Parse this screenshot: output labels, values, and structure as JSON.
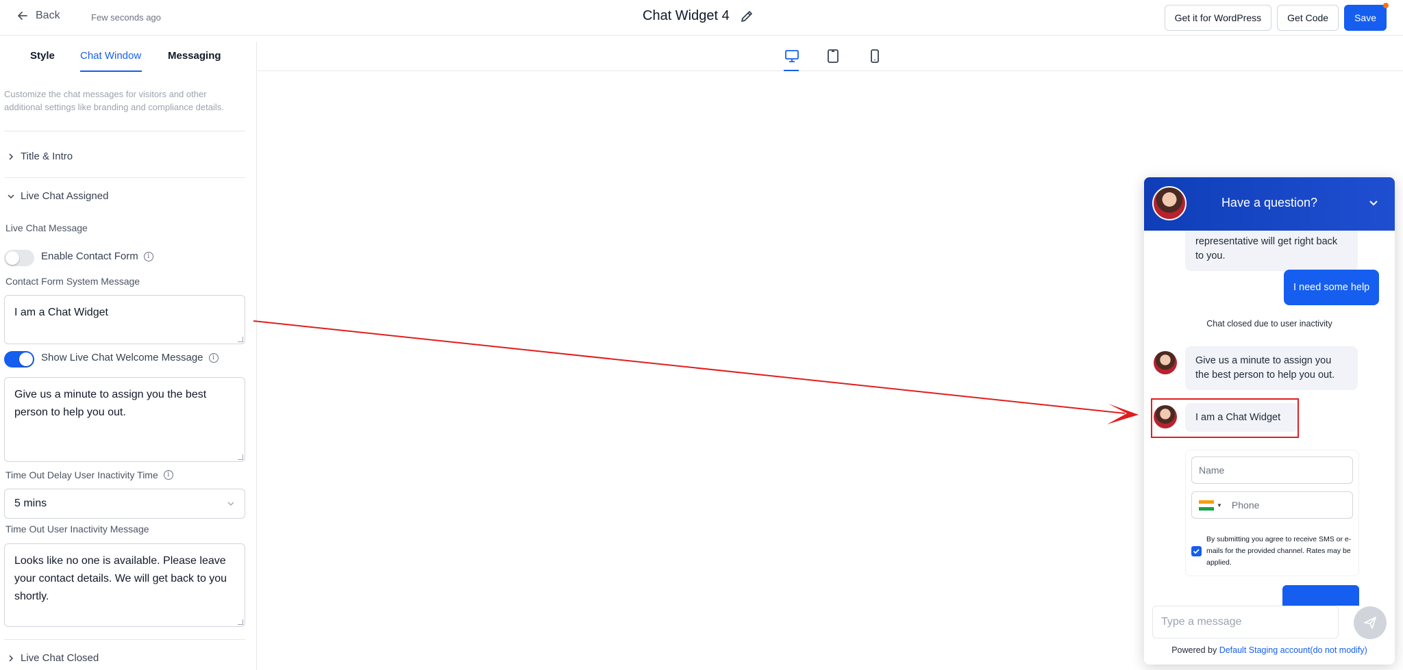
{
  "topbar": {
    "back_label": "Back",
    "saved_status": "Few seconds ago",
    "widget_title": "Chat Widget 4",
    "wordpress_label": "Get it for WordPress",
    "get_code_label": "Get Code",
    "save_label": "Save"
  },
  "tabs": [
    {
      "label": "Style"
    },
    {
      "label": "Chat Window"
    },
    {
      "label": "Messaging"
    }
  ],
  "panel": {
    "description": "Customize the chat messages for visitors and other additional settings like branding and compliance details.",
    "section_title_intro": "Title & Intro",
    "section_live_chat_assigned": "Live Chat Assigned",
    "live_chat_message_label": "Live Chat Message",
    "enable_contact_form_label": "Enable Contact Form",
    "enable_contact_form_on": false,
    "contact_form_system_message_label": "Contact Form System Message",
    "contact_form_system_message": "I am a Chat Widget",
    "show_welcome_label": "Show Live Chat Welcome Message",
    "show_welcome_on": true,
    "welcome_message": "Give us a minute to assign you the best person to help you out.",
    "timeout_delay_label": "Time Out Delay User Inactivity Time",
    "timeout_delay_value": "5 mins",
    "timeout_message_label": "Time Out User Inactivity Message",
    "timeout_message": "Looks like no one is available. Please leave your contact details. We will get back to you shortly.",
    "section_live_chat_closed": "Live Chat Closed"
  },
  "devices": [
    "desktop-icon",
    "tablet-icon",
    "mobile-icon"
  ],
  "widget": {
    "header_title": "Have a question?",
    "partial_message": "representative will get right back to you.",
    "user_message": "I need some help",
    "system_notice": "Chat closed due to user inactivity",
    "welcome_message": "Give us a minute to assign you the best person to help you out.",
    "contact_system_message": "I am a Chat Widget",
    "name_placeholder": "Name",
    "phone_placeholder": "Phone",
    "consent_text": "By submitting you agree to receive SMS or e-mails for the provided channel. Rates may be applied.",
    "consent_checked": true,
    "composer_placeholder": "Type a message",
    "powered_by_label": "Powered by",
    "powered_by_link": "Default Staging account(do not modify)"
  },
  "colors": {
    "accent": "#155eef",
    "widget_header": "#1f4fd1",
    "annotation": "#e11d1d"
  }
}
